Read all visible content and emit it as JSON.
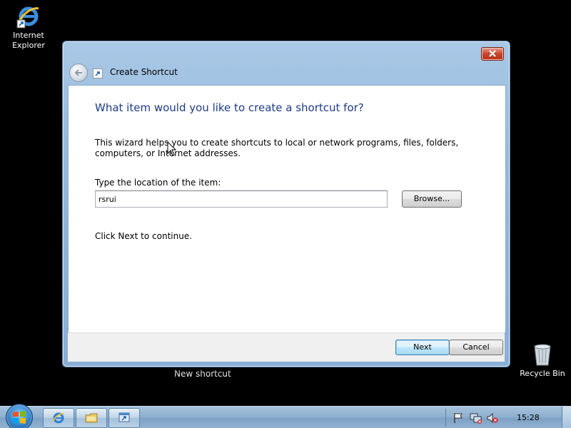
{
  "desktop": {
    "ie_icon_label_line1": "Internet",
    "ie_icon_label_line2": "Explorer",
    "recycle_label": "Recycle Bin",
    "new_shortcut_label": "New shortcut"
  },
  "dialog": {
    "title": "Create Shortcut",
    "heading": "What item would you like to create a shortcut for?",
    "description": "This wizard helps you to create shortcuts to local or network programs, files, folders, computers, or Internet addresses.",
    "location_label": "Type the location of the item:",
    "location_value": "rsrui",
    "browse_label": "Browse...",
    "continue_text": "Click Next to continue.",
    "next_label": "Next",
    "cancel_label": "Cancel"
  },
  "taskbar": {
    "clock": "15:28",
    "items": [
      "internet-explorer",
      "windows-explorer",
      "create-shortcut"
    ]
  },
  "colors": {
    "heading": "#1e3a87",
    "window_frame": "#94b8dc",
    "taskbar": "#8fb0cf",
    "close_button": "#c7452c"
  }
}
